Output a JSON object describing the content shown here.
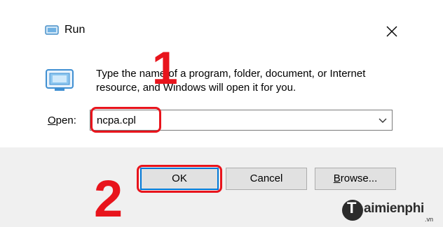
{
  "window": {
    "title": "Run",
    "icon": "run-icon",
    "close_icon": "close-icon"
  },
  "dialog": {
    "description_line1": "Type the name of a program, folder, document, or Internet",
    "description_line2": "resource, and Windows will open it for you.",
    "open_label_prefix": "O",
    "open_label_rest": "pen:",
    "open_value": "ncpa.cpl"
  },
  "buttons": {
    "ok": "OK",
    "cancel": "Cancel",
    "browse_prefix": "B",
    "browse_rest": "rowse..."
  },
  "annotations": {
    "step1": "1",
    "step2": "2",
    "highlight_color": "#e8141c"
  },
  "watermark": {
    "logo_letter": "T",
    "brand": "aimienphi",
    "suffix": ".vn"
  },
  "colors": {
    "accent_focus": "#0078d7",
    "footer_bg": "#f0f0f0"
  }
}
